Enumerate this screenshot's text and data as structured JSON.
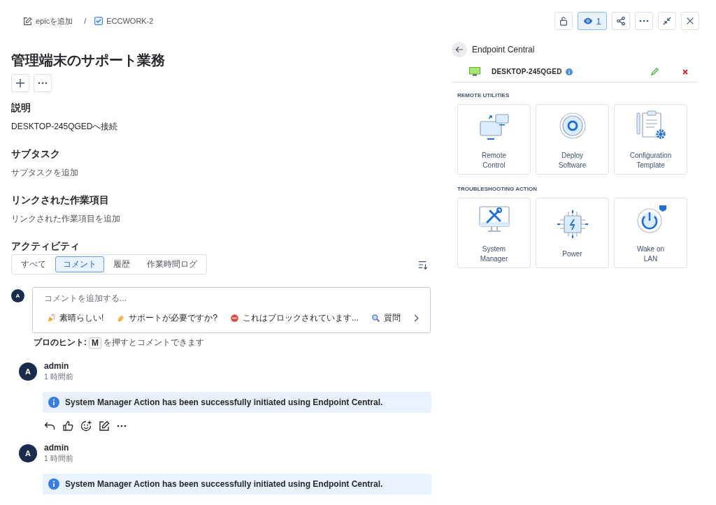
{
  "breadcrumb": {
    "epic_link": "epicを追加",
    "separator": "/",
    "issue_key": "ECCWORK-2"
  },
  "toolbar": {
    "watch": {
      "count": "1",
      "selected": true
    }
  },
  "title": "管理端末のサポート業務",
  "sections": [
    {
      "heading": "説明",
      "text": "DESKTOP-245QGEDへ接続",
      "kind": "value"
    },
    {
      "heading": "サブタスク",
      "text": "サブタスクを追加",
      "kind": "placeholder"
    },
    {
      "heading": "リンクされた作業項目",
      "text": "リンクされた作業項目を追加",
      "kind": "placeholder"
    }
  ],
  "activity": {
    "heading": "アクティビティ",
    "tabs": [
      {
        "label": "すべて",
        "selected": false
      },
      {
        "label": "コメント",
        "selected": true
      },
      {
        "label": "履歴",
        "selected": false
      },
      {
        "label": "作業時間ログ",
        "selected": false
      }
    ],
    "composer": {
      "avatar": "A",
      "placeholder": "コメントを追加する...",
      "quick_replies": [
        {
          "kind": "celebrate",
          "label": "素晴らしい!"
        },
        {
          "kind": "wave",
          "label": "サポートが必要ですか?"
        },
        {
          "kind": "blocked",
          "label": "これはブロックされています..."
        },
        {
          "kind": "question",
          "label": "質問"
        }
      ]
    },
    "hint": {
      "label": "プロのヒント:",
      "key": "M",
      "text": "を押すとコメントできます"
    }
  },
  "comments": [
    {
      "avatar": "A",
      "author": "admin",
      "time": "1 時間前",
      "message": "System Manager Action has been successfully initiated using Endpoint Central.",
      "actions": true
    },
    {
      "avatar": "A",
      "author": "admin",
      "time": "1 時間前",
      "message": "System Manager Action has been successfully initiated using Endpoint Central.",
      "actions": false
    }
  ],
  "panel": {
    "title": "Endpoint Central",
    "device": "DESKTOP-245QGED",
    "groups": [
      {
        "heading": "REMOTE UTILITIES",
        "tiles": [
          {
            "kind": "remote",
            "label": "Remote\nControl"
          },
          {
            "kind": "deploy",
            "label": "Deploy\nSoftware"
          },
          {
            "kind": "config",
            "label": "Configuration\nTemplate"
          }
        ]
      },
      {
        "heading": "TROUBLESHOOTING ACTION",
        "tiles": [
          {
            "kind": "system",
            "label": "System\nManager"
          },
          {
            "kind": "power",
            "label": "Power"
          },
          {
            "kind": "wol",
            "label": "Wake on\nLAN"
          }
        ]
      }
    ]
  }
}
